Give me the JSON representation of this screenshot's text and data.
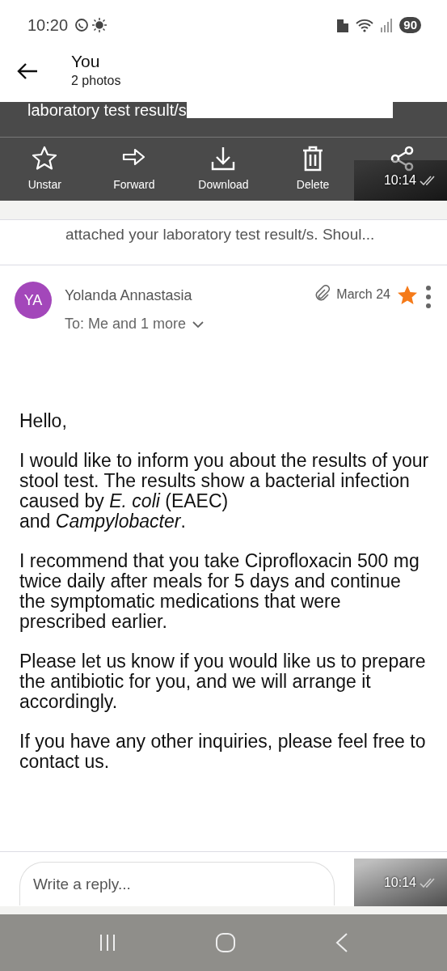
{
  "status_bar": {
    "time": "10:20",
    "battery": "90"
  },
  "header": {
    "title": "You",
    "subtitle": "2 photos"
  },
  "caption": {
    "text": "laboratory test result/s"
  },
  "toolbar": [
    {
      "kind": "star",
      "label": "Unstar"
    },
    {
      "kind": "forward",
      "label": "Forward"
    },
    {
      "kind": "download",
      "label": "Download"
    },
    {
      "kind": "delete",
      "label": "Delete"
    },
    {
      "kind": "share"
    }
  ],
  "toolbar_timestamp": "10:14",
  "preview": "attached your laboratory test result/s. Shoul...",
  "message": {
    "initials": "YA",
    "sender": "Yolanda Annastasia",
    "recipients": "To:  Me and 1 more",
    "date": "March 24",
    "starred": true,
    "has_attachment": true
  },
  "body": [
    [
      "Hello,"
    ],
    [
      "I would like to inform you about the results of your stool test. The results show a bacterial infection caused by *E. coli* (EAEC)",
      "and *Campylobacter*."
    ],
    [
      "I recommend that you take Ciprofloxacin 500 mg twice daily after meals for 5 days and continue the symptomatic medications that were prescribed earlier."
    ],
    [
      "Please let us know if you would like us to prepare the antibiotic for you, and we will arrange it accordingly."
    ],
    [
      "If you have any other inquiries, please feel free to contact us."
    ]
  ],
  "reply": {
    "placeholder": "Write a reply..."
  },
  "reply_timestamp": "10:14"
}
